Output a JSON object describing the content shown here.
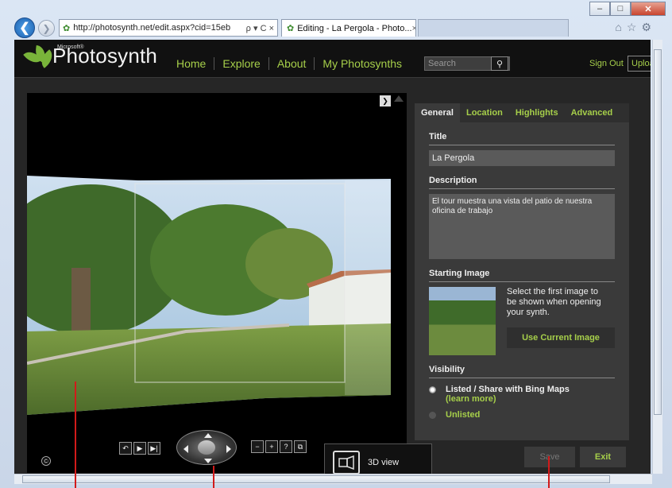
{
  "browser": {
    "address_url": "http://photosynth.net/edit.aspx?cid=15eb",
    "address_controls": "ρ ▾ C ×",
    "active_tab": "Editing - La Pergola - Photo...",
    "window_buttons": {
      "minimize": "–",
      "maximize": "□",
      "close": "✕"
    }
  },
  "site": {
    "brand": {
      "small": "Microsoft®",
      "name": "Photosynth"
    },
    "nav": [
      "Home",
      "Explore",
      "About",
      "My Photosynths"
    ],
    "search_placeholder": "Search",
    "sign_out": "Sign Out",
    "upload": "Upload"
  },
  "panel": {
    "tabs": [
      "General",
      "Location",
      "Highlights",
      "Advanced"
    ],
    "title_label": "Title",
    "title_value": "La Pergola",
    "description_label": "Description",
    "description_value": "El tour muestra una vista del patio de nuestra oficina de trabajo",
    "starting_image_label": "Starting Image",
    "starting_image_text": "Select the first image to be shown when opening your synth.",
    "use_current_image": "Use Current Image",
    "visibility_label": "Visibility",
    "visibility_options": [
      {
        "label": "Listed / Share with Bing Maps",
        "sublabel": "(learn more)",
        "selected": true
      },
      {
        "label": "Unlisted",
        "selected": false
      }
    ]
  },
  "viewer": {
    "tooltip_label": "3D view",
    "copyright_symbol": "©"
  },
  "actions": {
    "save": "Save",
    "exit": "Exit"
  }
}
